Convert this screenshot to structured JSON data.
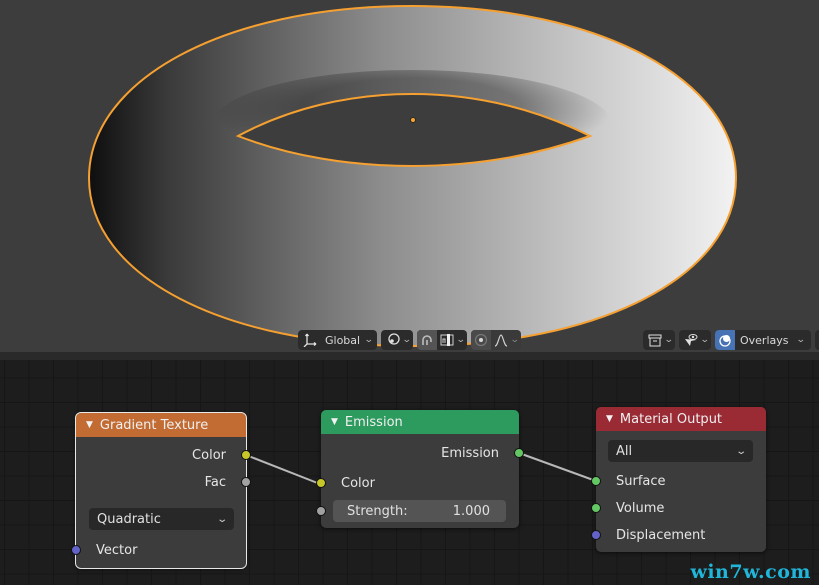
{
  "viewport": {
    "object": "torus",
    "selection_color": "#f5a030",
    "toolbar_center": {
      "transform_orientation": {
        "icon": "transform-orientation-icon",
        "label": "Global"
      },
      "pivot_point": {
        "icon": "pivot-point-icon"
      },
      "snap": {
        "icon": "snap-magnet-icon",
        "active": true
      },
      "snap_target": {
        "icon": "snap-increment-icon"
      },
      "proportional_editing": {
        "icon": "proportional-edit-icon"
      },
      "proportional_falloff": {
        "icon": "falloff-curve-icon"
      }
    },
    "toolbar_right": {
      "object_types": {
        "icon": "object-type-visibility-icon"
      },
      "gizmos": {
        "icon": "gizmo-icon"
      },
      "overlays": {
        "icon": "overlays-icon",
        "label": "Overlays"
      }
    }
  },
  "node_editor": {
    "nodes": [
      {
        "title": "Gradient Texture",
        "header_color": "#c26b32",
        "selected": true,
        "outputs": [
          {
            "label": "Color",
            "socket_color": "#c7c729"
          },
          {
            "label": "Fac",
            "socket_color": "#a1a1a1"
          }
        ],
        "dropdown": {
          "value": "Quadratic"
        },
        "inputs": [
          {
            "label": "Vector",
            "socket_color": "#6363c7"
          }
        ]
      },
      {
        "title": "Emission",
        "header_color": "#2d9a5e",
        "selected": false,
        "outputs": [
          {
            "label": "Emission",
            "socket_color": "#63c763"
          }
        ],
        "inputs": [
          {
            "label": "Color",
            "socket_color": "#c7c729"
          },
          {
            "label": "Strength:",
            "value": "1.000",
            "socket_color": "#a1a1a1"
          }
        ]
      },
      {
        "title": "Material Output",
        "header_color": "#9a2b35",
        "selected": false,
        "dropdown": {
          "value": "All"
        },
        "inputs": [
          {
            "label": "Surface",
            "socket_color": "#63c763"
          },
          {
            "label": "Volume",
            "socket_color": "#63c763"
          },
          {
            "label": "Displacement",
            "socket_color": "#6363c7"
          }
        ]
      }
    ],
    "links": [
      {
        "from": "Gradient Texture.Color",
        "to": "Emission.Color"
      },
      {
        "from": "Emission.Emission",
        "to": "Material Output.Surface"
      }
    ]
  },
  "watermark": "win7w.com"
}
